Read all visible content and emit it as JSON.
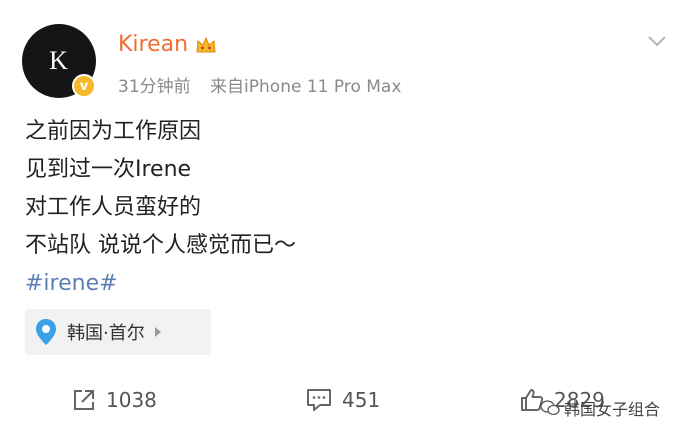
{
  "post": {
    "avatar_letter": "K",
    "username": "Kirean",
    "time": "31分钟前",
    "source": "来自iPhone 11 Pro Max",
    "lines": [
      "之前因为工作原因",
      "见到过一次Irene",
      "对工作人员蛮好的",
      "不站队 说说个人感觉而已～"
    ],
    "hashtag": "#irene#",
    "location": "韩国·首尔"
  },
  "actions": {
    "repost_count": "1038",
    "comment_count": "451",
    "like_count": "2829"
  },
  "watermark": "韩国女子组合",
  "colors": {
    "username": "#f26d2d",
    "hashtag": "#5b7fb3",
    "verified": "#f5b82a"
  },
  "icons": [
    "verified-badge-icon",
    "vip-crown-icon",
    "chevron-down-icon",
    "location-pin-icon",
    "share-icon",
    "comment-icon",
    "like-icon",
    "wechat-icon"
  ]
}
